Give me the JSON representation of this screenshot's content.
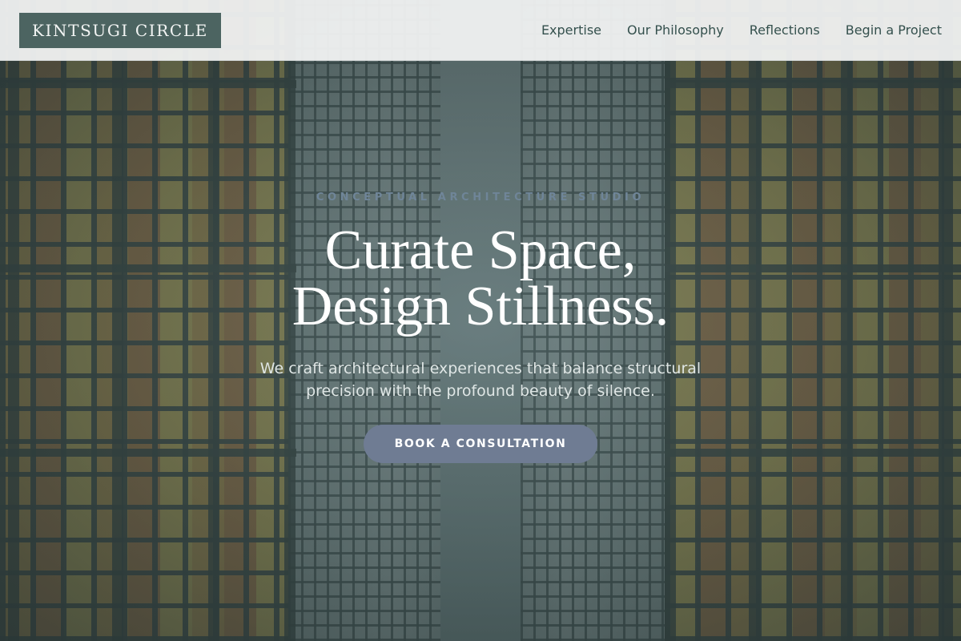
{
  "header": {
    "logo_text": "KINTSUGI CIRCLE",
    "nav": [
      {
        "label": "Expertise"
      },
      {
        "label": "Our Philosophy"
      },
      {
        "label": "Reflections"
      },
      {
        "label": "Begin a Project"
      }
    ]
  },
  "hero": {
    "eyebrow": "CONCEPTUAL ARCHITECTURE STUDIO",
    "headline_line1": "Curate Space,",
    "headline_line2": "Design Stillness.",
    "subhead": "We craft architectural experiences that balance structural precision with the profound beauty of silence.",
    "cta_label": "BOOK A CONSULTATION"
  },
  "colors": {
    "logo_bg": "#4c6461",
    "nav_text": "#34504d",
    "eyebrow": "#6f8598",
    "cta_bg": "#6f7c93",
    "header_bg": "#f4f5f5"
  }
}
